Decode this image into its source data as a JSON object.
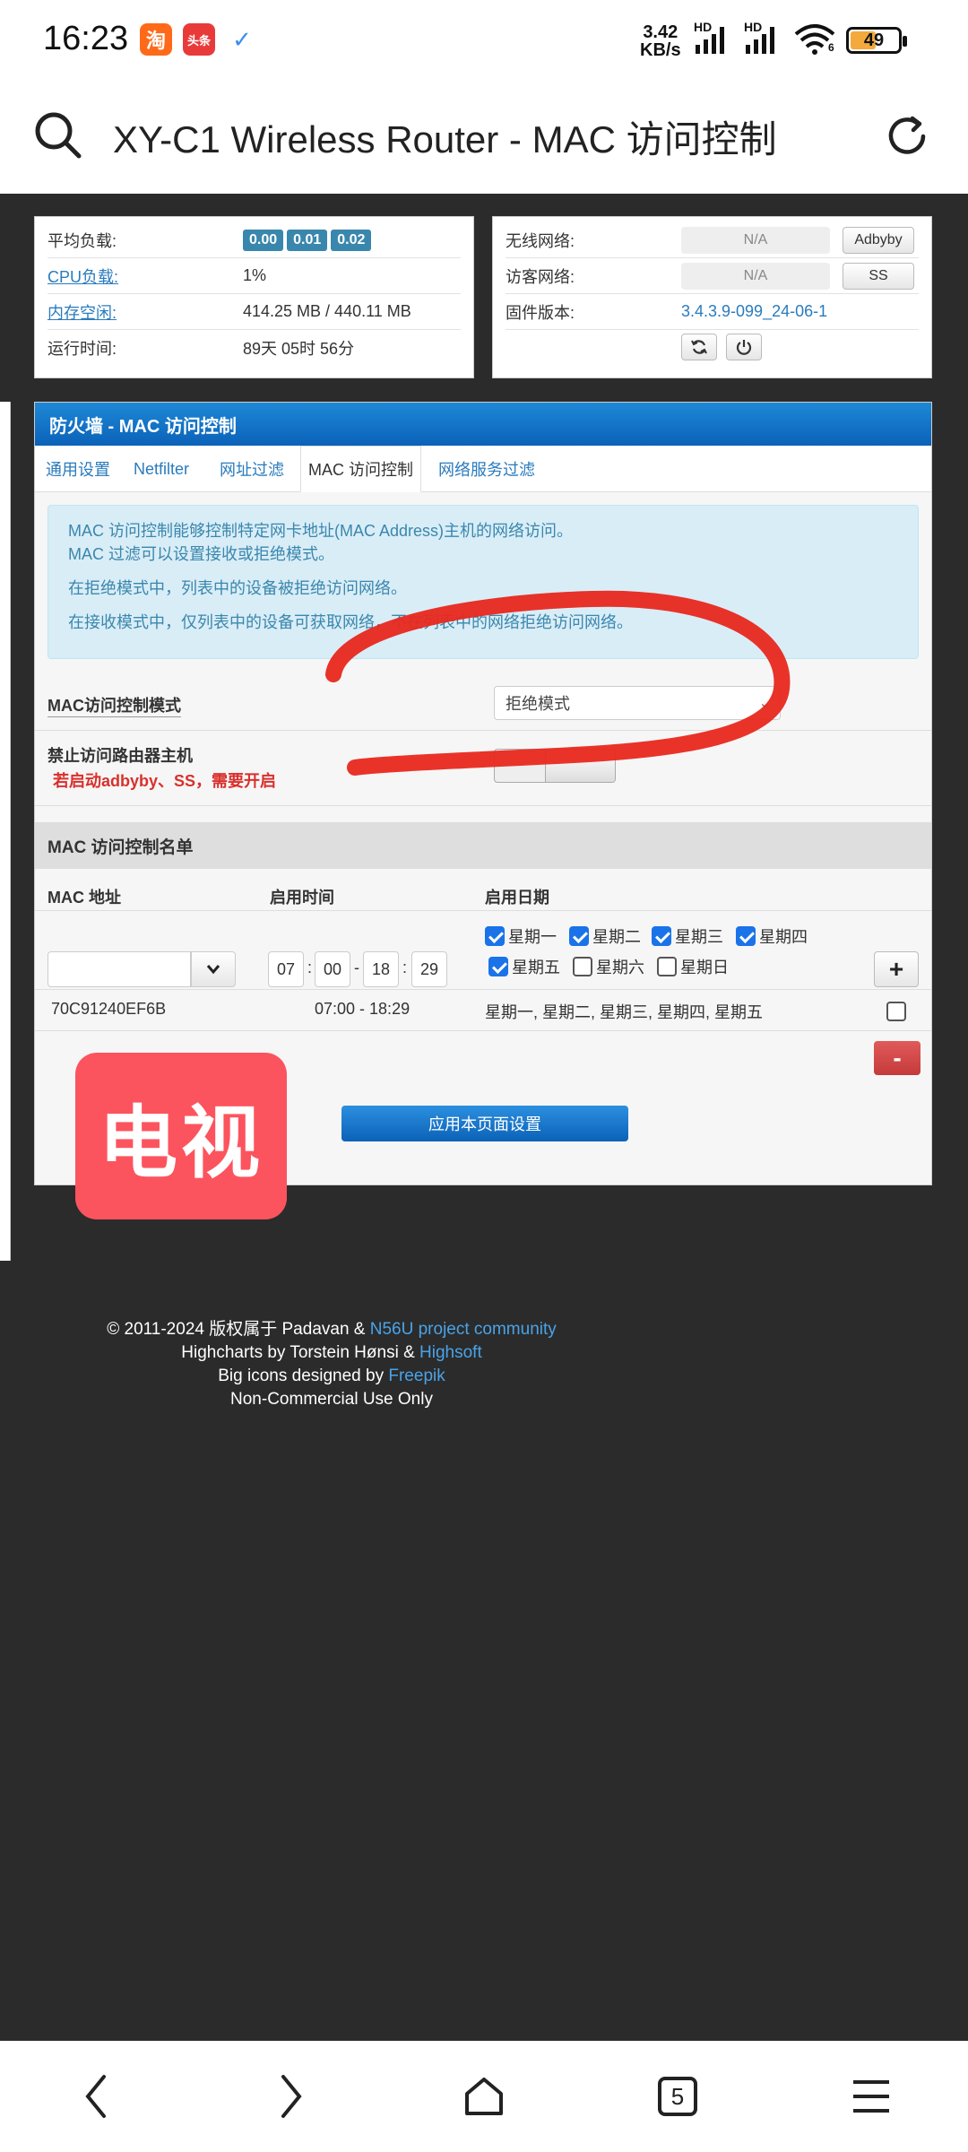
{
  "status_bar": {
    "time": "16:23",
    "app_taobao": "淘",
    "app_toutiao": "头条",
    "net_speed_value": "3.42",
    "net_speed_unit": "KB/s",
    "hd1": "HD",
    "hd2": "HD",
    "wifi_extra": "6",
    "battery": "49"
  },
  "browser": {
    "title": "XY-C1 Wireless Router - MAC 访问控制"
  },
  "info_left": {
    "load_label": "平均负载:",
    "load_values": [
      "0.00",
      "0.01",
      "0.02"
    ],
    "cpu_label": "CPU负载:",
    "cpu_value": "1%",
    "mem_label": "内存空闲:",
    "mem_value": "414.25 MB / 440.11 MB",
    "uptime_label": "运行时间:",
    "uptime_value": "89天 05时 56分"
  },
  "info_right": {
    "wireless_label": "无线网络:",
    "wireless_value": "N/A",
    "wireless_btn": "Adbyby",
    "guest_label": "访客网络:",
    "guest_value": "N/A",
    "guest_btn": "SS",
    "fw_label": "固件版本:",
    "fw_value": "3.4.3.9-099_24-06-1"
  },
  "panel": {
    "header": "防火墙 - MAC 访问控制",
    "tabs": [
      "通用设置",
      "Netfilter",
      "网址过滤",
      "MAC 访问控制",
      "网络服务过滤"
    ],
    "notice": [
      "MAC 访问控制能够控制特定网卡地址(MAC Address)主机的网络访问。",
      "MAC 过滤可以设置接收或拒绝模式。",
      "在拒绝模式中，列表中的设备被拒绝访问网络。",
      "在接收模式中，仅列表中的设备可获取网络，不在列表中的网络拒绝访问网络。"
    ],
    "mode_label": "MAC访问控制模式",
    "mode_value": "拒绝模式",
    "block_label": "禁止访问路由器主机",
    "block_warning": "若启动adbyby、SS，需要开启",
    "list_title": "MAC 访问控制名单",
    "col_mac": "MAC 地址",
    "col_time": "启用时间",
    "col_date": "启用日期",
    "time_inputs": [
      "07",
      "00",
      "18",
      "29"
    ],
    "time_sep_colon": ":",
    "time_sep_dash": "-",
    "days": [
      {
        "label": "星期一",
        "checked": true
      },
      {
        "label": "星期二",
        "checked": true
      },
      {
        "label": "星期三",
        "checked": true
      },
      {
        "label": "星期四",
        "checked": true
      },
      {
        "label": "星期五",
        "checked": true
      },
      {
        "label": "星期六",
        "checked": false
      },
      {
        "label": "星期日",
        "checked": false
      }
    ],
    "add_btn": "+",
    "entry": {
      "mac": "70C91240EF6B",
      "time": "07:00 - 18:29",
      "days": "星期一, 星期二, 星期三, 星期四, 星期五"
    },
    "del_btn": "-",
    "apply_btn": "应用本页面设置"
  },
  "sticker": "电视",
  "footer": {
    "line1_text": "© 2011-2024 版权属于 Padavan & ",
    "line1_link": "N56U project community",
    "line2_text": "Highcharts by Torstein Hønsi & ",
    "line2_link": "Highsoft",
    "line3_text": "Big icons designed by ",
    "line3_link": "Freepik",
    "line4_text": "Non-Commercial Use Only"
  },
  "nav": {
    "tab_count": "5"
  },
  "colors": {
    "header_blue": "#0b62b8",
    "link": "#2a7bbd",
    "warning_red": "#d9302c",
    "sticker_red": "#fc545e",
    "scribble_red": "#e8281e"
  }
}
